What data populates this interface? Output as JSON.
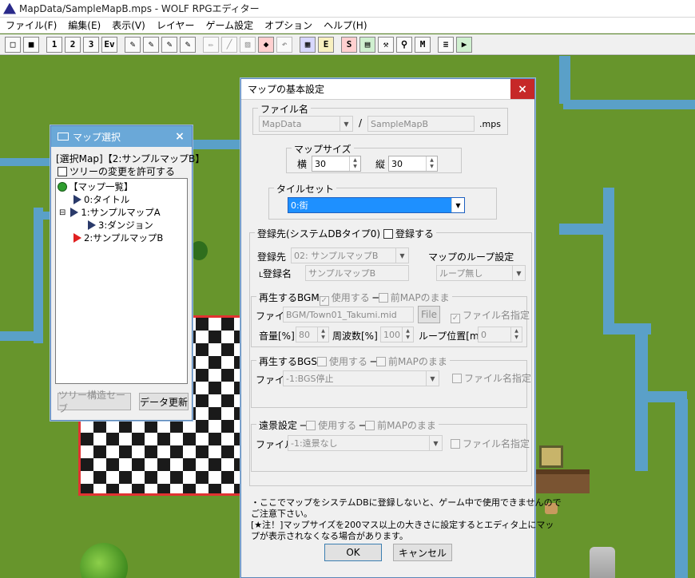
{
  "window": {
    "title": "MapData/SampleMapB.mps - WOLF RPGエディター"
  },
  "menu": [
    "ファイル(F)",
    "編集(E)",
    "表示(V)",
    "レイヤー",
    "ゲーム設定",
    "オプション",
    "ヘルプ(H)"
  ],
  "toolbar": {
    "layer1": "1",
    "layer2": "2",
    "layer3": "3",
    "event": "Ev"
  },
  "map_select": {
    "title": "マップ選択",
    "selected": "[選択Map]【2:サンプルマップB】",
    "allow_tree_change": "ツリーの変更を許可する",
    "tree": {
      "root": "【マップ一覧】",
      "item0": "0:タイトル",
      "item1": "1:サンプルマップA",
      "item3": "3:ダンジョン",
      "item2": "2:サンプルマップB"
    },
    "save_tree": "ツリー構造セーブ",
    "refresh": "データ更新"
  },
  "dialog": {
    "title": "マップの基本設定",
    "close": "×",
    "file_group": "ファイル名",
    "folder": "MapData",
    "slash": "/",
    "filename": "SampleMapB",
    "ext": ".mps",
    "size_group": "マップサイズ",
    "width_label": "横",
    "width": "30",
    "height_label": "縦",
    "height": "30",
    "tileset_group": "タイルセット",
    "tileset": "0:街",
    "register_group": "登録先(システムDBタイプ0)",
    "register_check": "登録する",
    "register_dest_label": "登録先",
    "register_dest": "02: サンプルマップB",
    "register_name_label": "登録名",
    "register_name": "サンプルマップB",
    "loop_label": "マップのループ設定",
    "loop": "ループ無し",
    "bgm": {
      "group": "再生するBGM",
      "use": "使用する",
      "keep": "前MAPのまま",
      "file_label": "ファイル",
      "file": "BGM/Town01_Takumi.mid",
      "file_btn": "File",
      "specify": "ファイル名指定",
      "vol_label": "音量[%]",
      "vol": "80",
      "freq_label": "周波数[%]",
      "freq": "100",
      "loop_label": "ループ位置[ms]",
      "loop": "0"
    },
    "bgs": {
      "group": "再生するBGS",
      "use": "使用する",
      "keep": "前MAPのまま",
      "file_label": "ファイル",
      "file": "-1:BGS停止",
      "specify": "ファイル名指定"
    },
    "bg": {
      "group": "遠景設定",
      "use": "使用する",
      "keep": "前MAPのまま",
      "file_label": "ファイル",
      "file": "-1:遠景なし",
      "specify": "ファイル名指定"
    },
    "note1": "・ここでマップをシステムDBに登録しないと、ゲーム中で使用できませんので",
    "note2": "ご注意下さい。",
    "note3": "[★注！]マップサイズを200マス以上の大きさに設定するとエディタ上にマッ",
    "note4": "プが表示されなくなる場合があります。",
    "ok": "OK",
    "cancel": "キャンセル"
  }
}
